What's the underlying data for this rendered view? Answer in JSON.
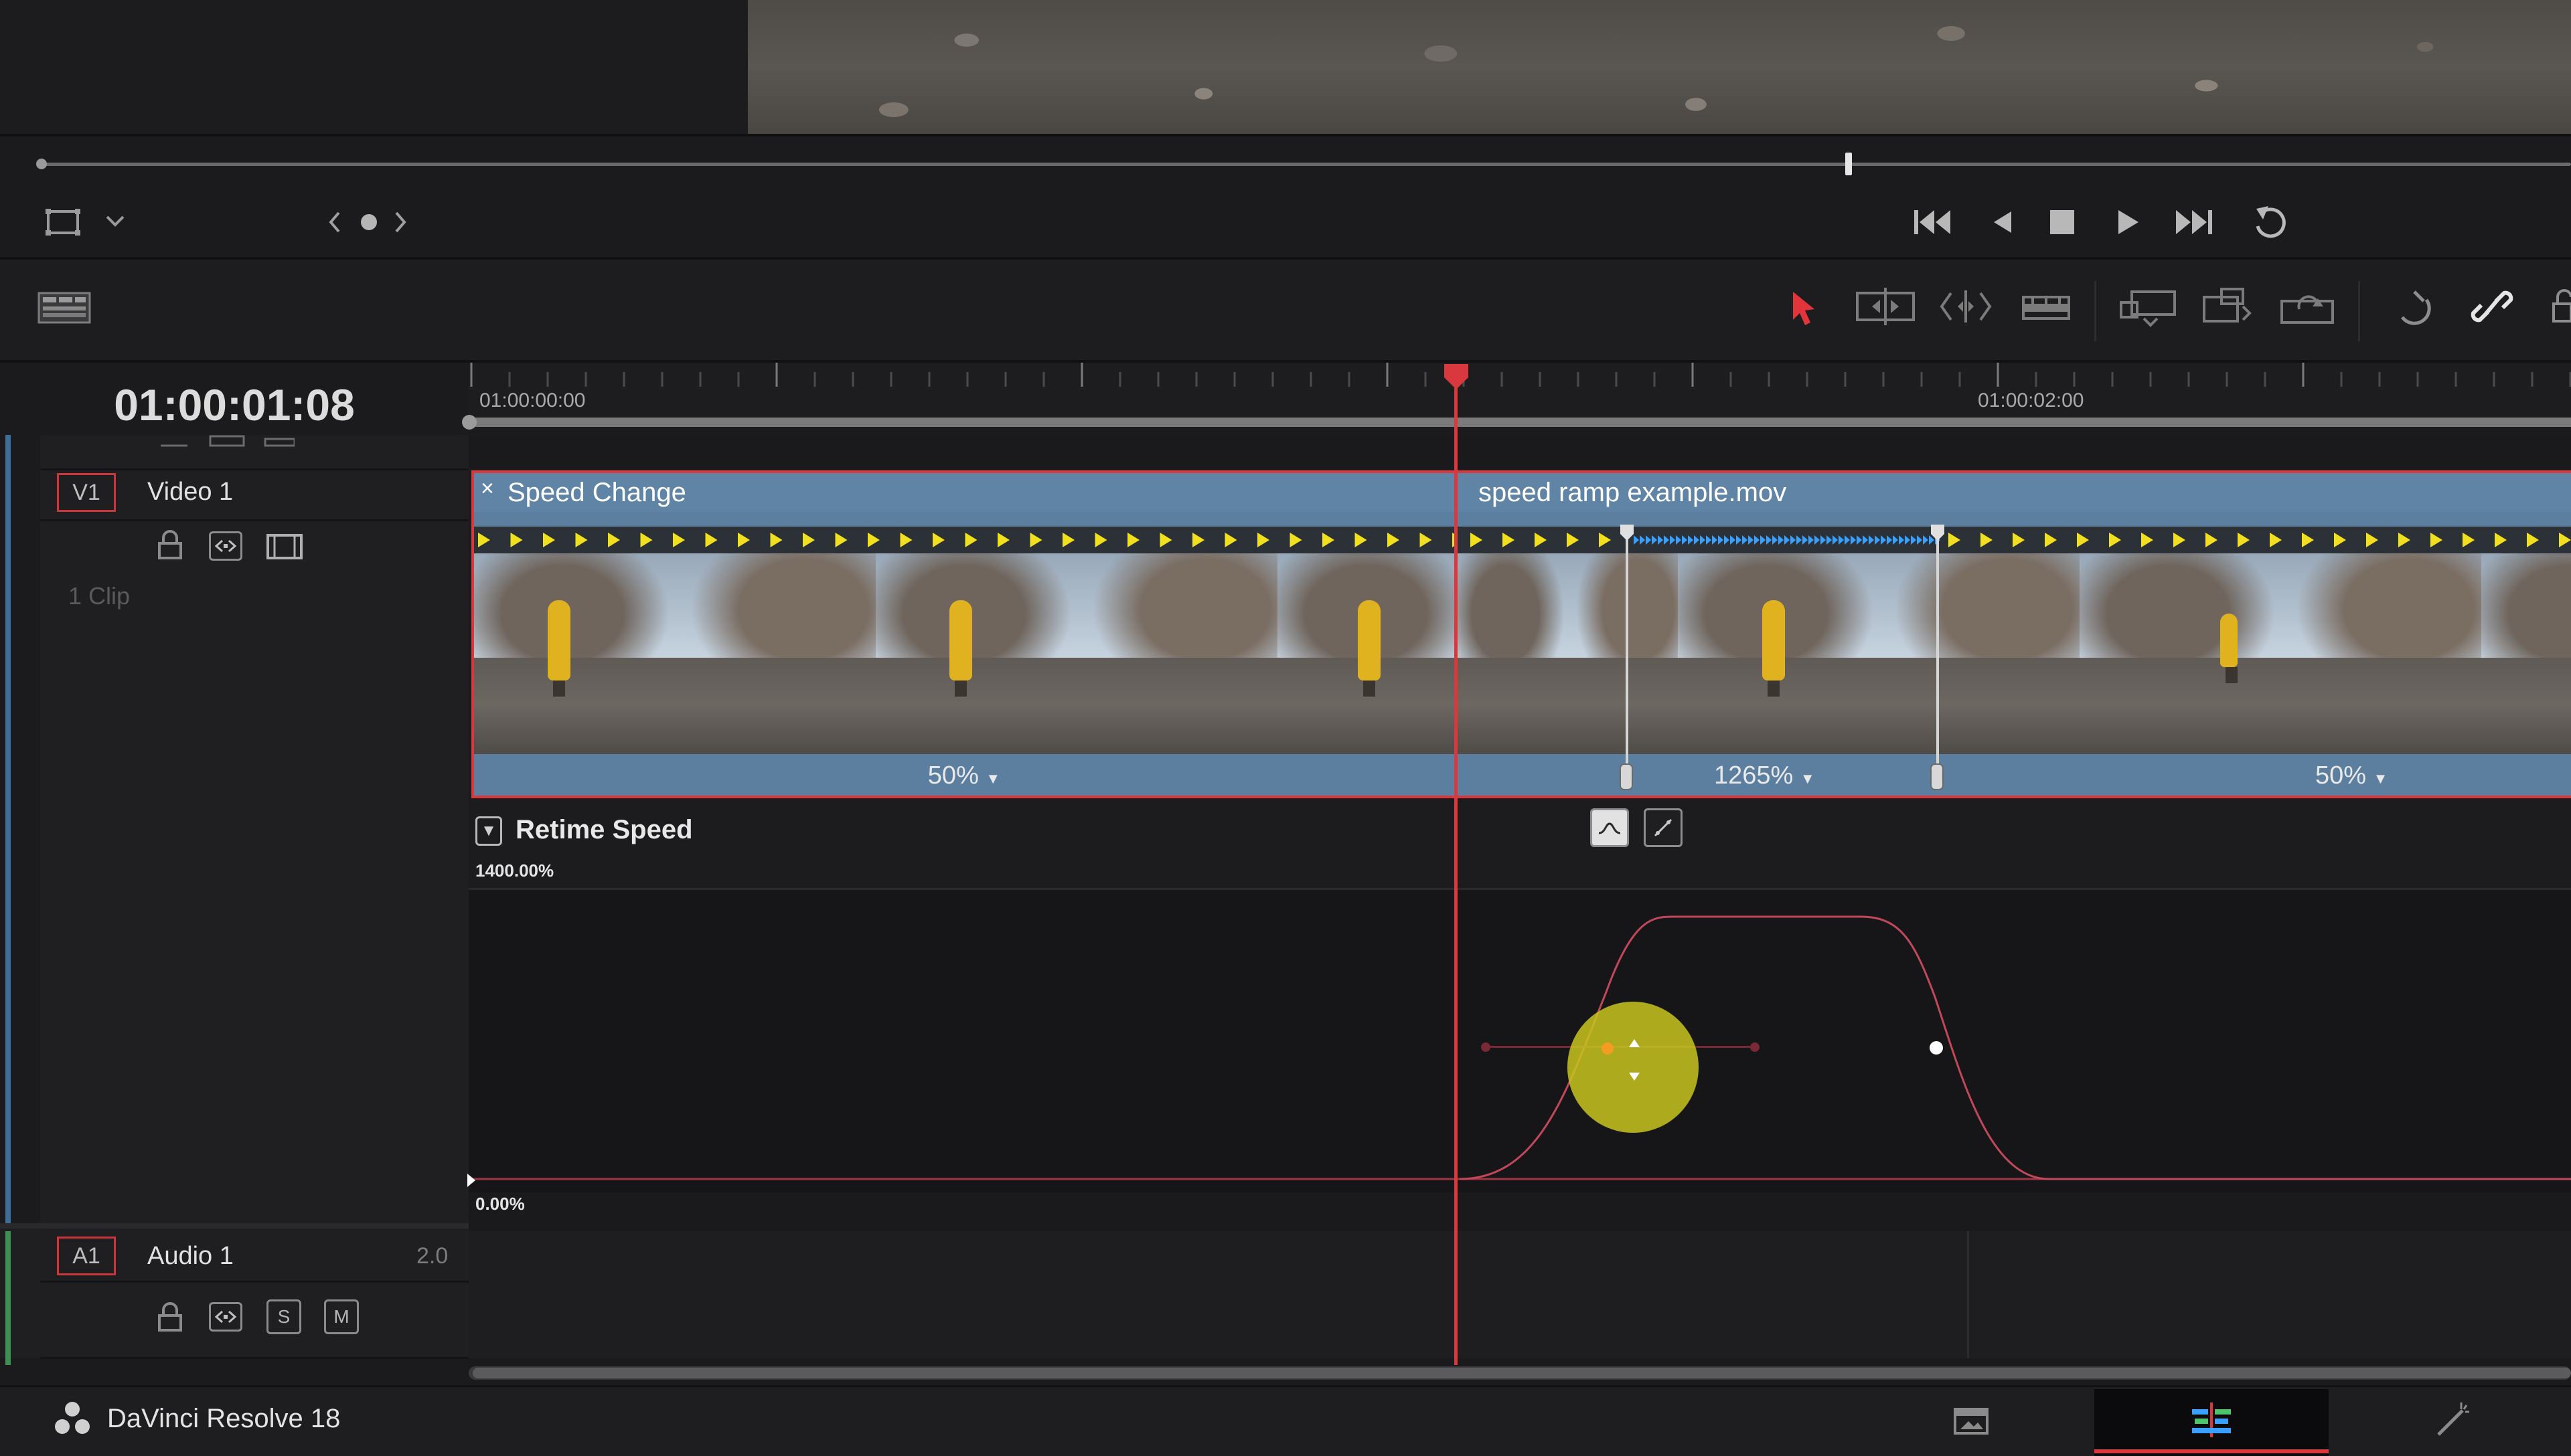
{
  "timeline": {
    "timecode": "01:00:01:08",
    "ruler_labels": [
      "01:00:00:00",
      "01:00:02:00"
    ]
  },
  "tracks": {
    "video": {
      "badge": "V1",
      "name": "Video 1",
      "clip_count": "1 Clip"
    },
    "audio": {
      "badge": "A1",
      "name": "Audio 1",
      "channels": "2.0",
      "solo_label": "S",
      "mute_label": "M"
    }
  },
  "clips": {
    "speed_change": {
      "title": "Speed Change",
      "close_glyph": "×",
      "speed": "50%"
    },
    "speed_ramp": {
      "title": "speed ramp example.mov",
      "speed_mid": "1265%",
      "speed_end": "50%"
    }
  },
  "retime": {
    "title": "Retime Speed",
    "max_label": "1400.00%",
    "min_label": "0.00%"
  },
  "footer": {
    "app_name": "DaVinci Resolve 18"
  },
  "colors": {
    "accent_red": "#d8383e",
    "clip_blue": "#5c7f9f",
    "speed_arrow_yellow": "#f0e020",
    "speed_arrow_blue": "#3aa0ff",
    "curve_red": "#c0485a",
    "keyframe_highlight": "#c8c61e"
  },
  "icons": [
    "transform-icon",
    "chevron-down-icon",
    "prev-icon",
    "dot-icon",
    "next-icon",
    "go-to-start-icon",
    "step-back-icon",
    "stop-icon",
    "play-icon",
    "go-to-end-icon",
    "loop-icon",
    "timeline-view-icon",
    "selection-pointer-icon",
    "trim-icon",
    "dynamic-trim-icon",
    "blade-icon",
    "insert-icon",
    "overwrite-icon",
    "replace-icon",
    "snapping-icon",
    "linked-selection-icon",
    "lock-icon",
    "auto-select-icon",
    "film-icon",
    "media-page-icon",
    "edit-page-icon",
    "color-page-icon"
  ]
}
